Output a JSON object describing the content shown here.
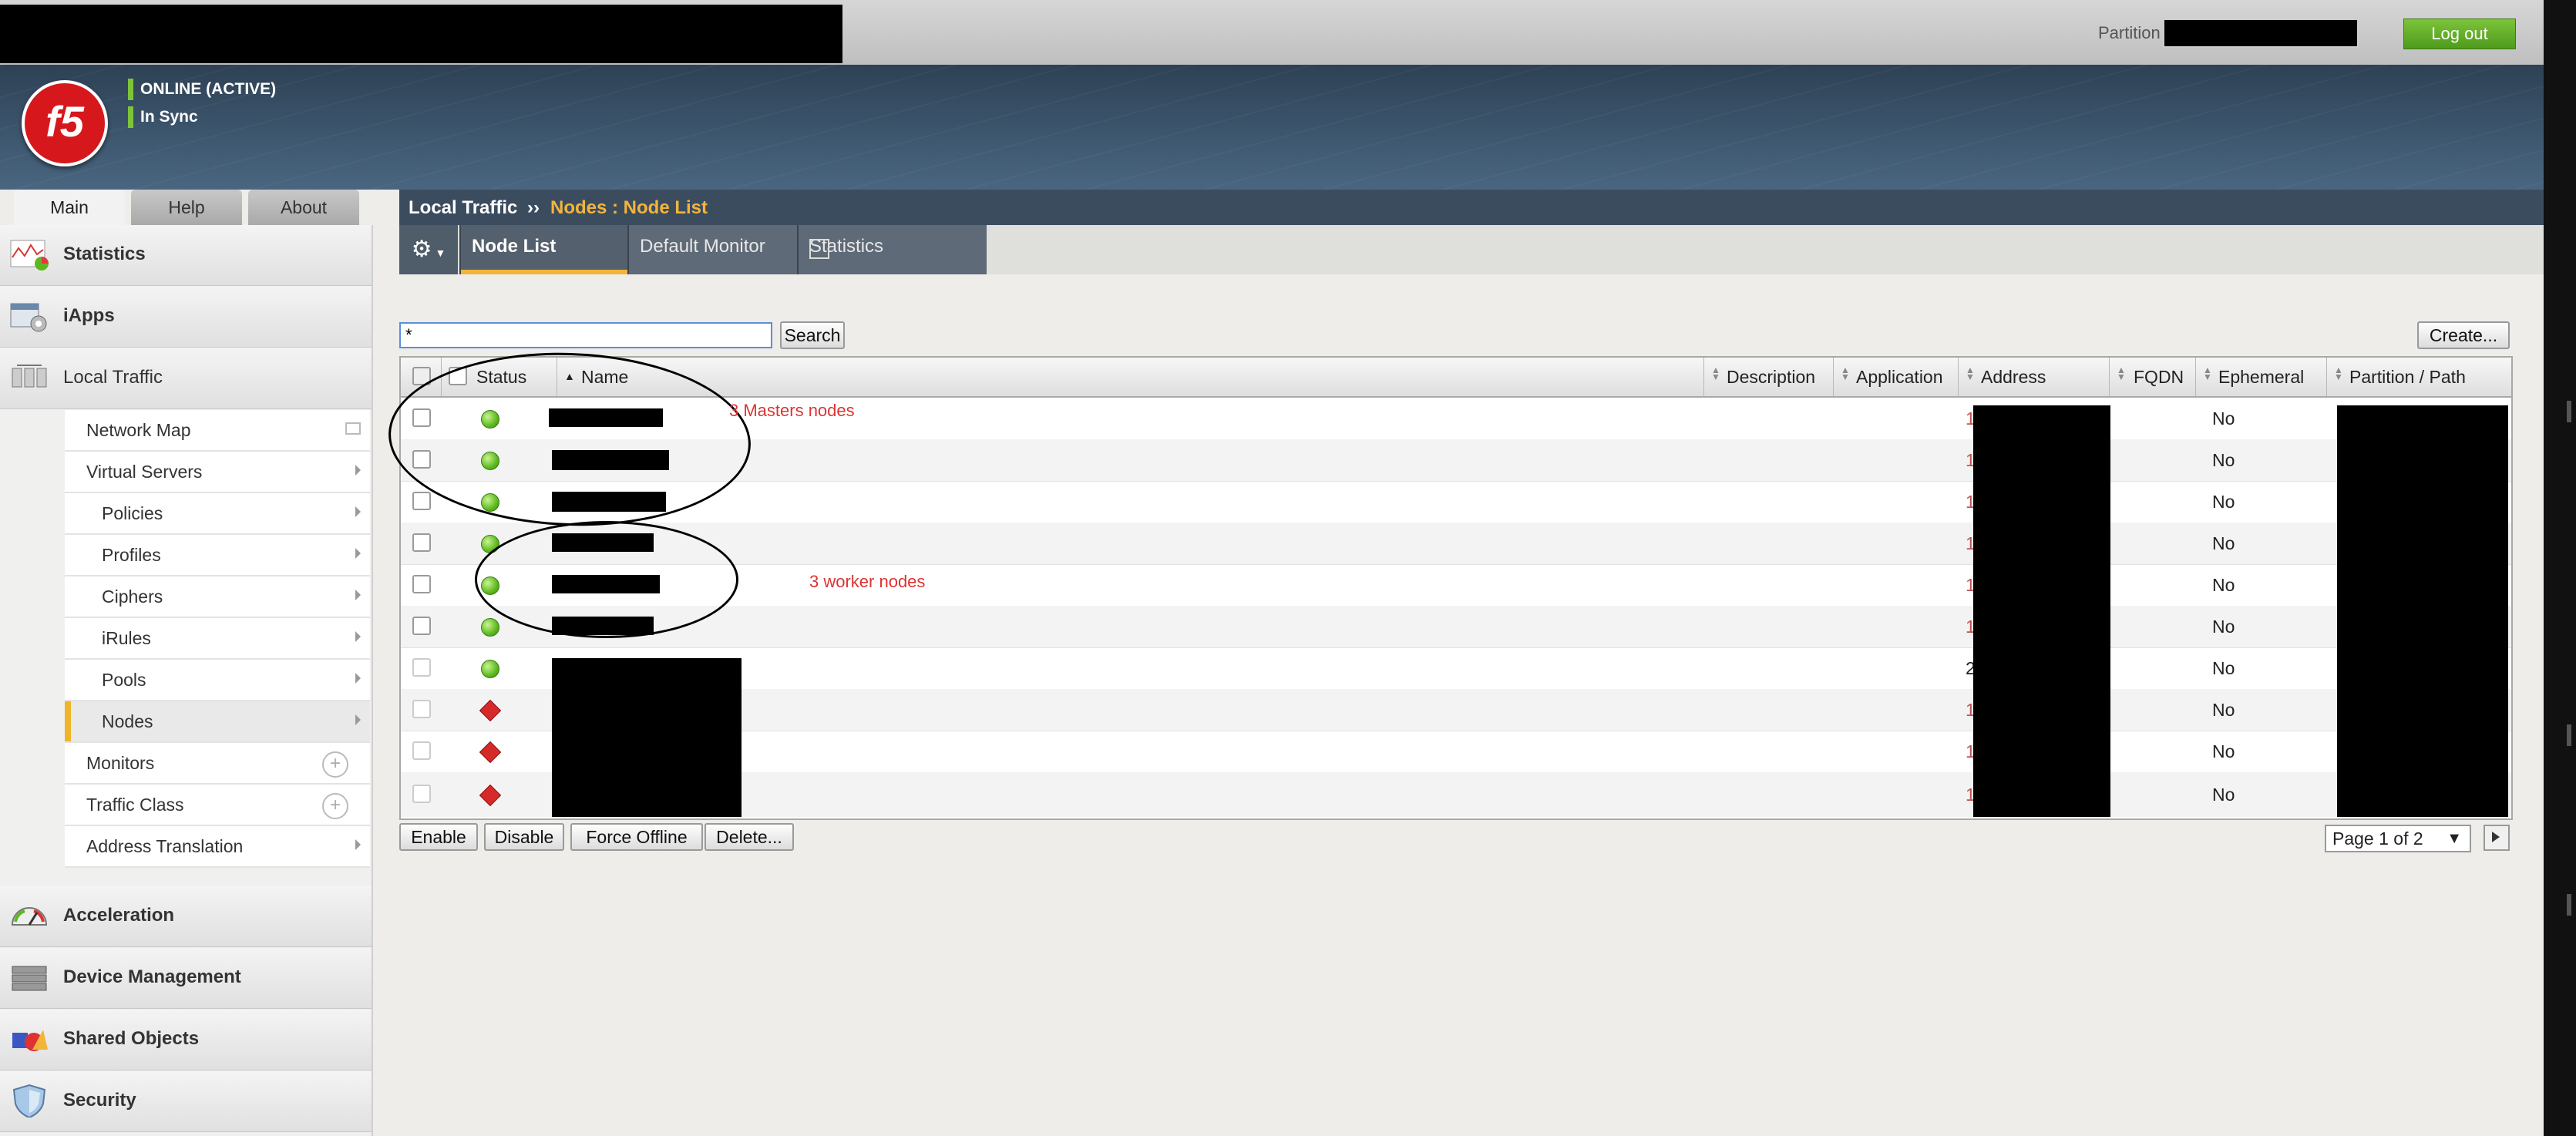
{
  "header": {
    "partition_label": "Partition",
    "logout_label": "Log out",
    "status_online": "ONLINE (ACTIVE)",
    "status_sync": "In Sync",
    "status_color": "#7cc43a"
  },
  "left_tabs": [
    "Main",
    "Help",
    "About"
  ],
  "nav": {
    "statistics": "Statistics",
    "iapps": "iApps",
    "local_traffic": "Local Traffic",
    "sub": {
      "network_map": "Network Map",
      "virtual_servers": "Virtual Servers",
      "policies": "Policies",
      "profiles": "Profiles",
      "ciphers": "Ciphers",
      "irules": "iRules",
      "pools": "Pools",
      "nodes": "Nodes",
      "monitors": "Monitors",
      "traffic_class": "Traffic Class",
      "address_translation": "Address Translation"
    },
    "acceleration": "Acceleration",
    "device_management": "Device Management",
    "shared_objects": "Shared Objects",
    "security": "Security"
  },
  "breadcrumb": {
    "root": "Local Traffic",
    "separator": "››",
    "current": "Nodes : Node List"
  },
  "subtabs": [
    "Node List",
    "Default Monitor",
    "Statistics"
  ],
  "search": {
    "value": "*",
    "button_label": "Search"
  },
  "create_label": "Create...",
  "table": {
    "columns": {
      "status": "Status",
      "name": "Name",
      "description": "Description",
      "application": "Application",
      "address": "Address",
      "fqdn": "FQDN",
      "ephemeral": "Ephemeral",
      "partition_path": "Partition / Path"
    },
    "rows": [
      {
        "status": "green",
        "ephemeral": "No",
        "address_prefix": "1"
      },
      {
        "status": "green",
        "ephemeral": "No",
        "address_prefix": "1"
      },
      {
        "status": "green",
        "ephemeral": "No",
        "address_prefix": "1"
      },
      {
        "status": "green",
        "ephemeral": "No",
        "address_prefix": "1"
      },
      {
        "status": "green",
        "ephemeral": "No",
        "address_prefix": "1"
      },
      {
        "status": "green",
        "ephemeral": "No",
        "address_prefix": "1"
      },
      {
        "status": "green",
        "ephemeral": "No",
        "address_prefix": "2"
      },
      {
        "status": "red",
        "ephemeral": "No",
        "address_prefix": "1"
      },
      {
        "status": "red",
        "ephemeral": "No",
        "address_prefix": "1"
      },
      {
        "status": "red",
        "ephemeral": "No",
        "address_prefix": "1"
      }
    ]
  },
  "annotations": {
    "masters": "3 Masters nodes",
    "workers": "3 worker nodes"
  },
  "actions": [
    "Enable",
    "Disable",
    "Force Offline",
    "Delete..."
  ],
  "pager": {
    "label": "Page 1 of 2"
  }
}
